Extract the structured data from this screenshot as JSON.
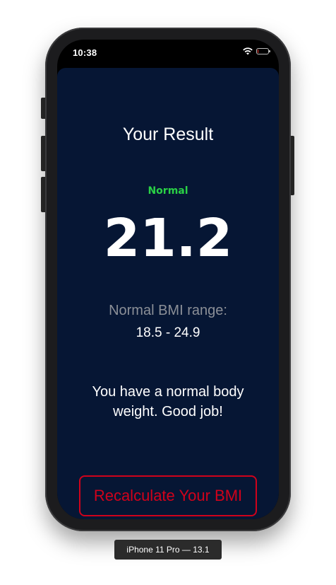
{
  "status_bar": {
    "time": "10:38",
    "battery_level": 0.1,
    "battery_color": "#ff3b30",
    "icons": [
      "wifi-icon",
      "battery-icon"
    ]
  },
  "result": {
    "title": "Your Result",
    "status": "Normal",
    "status_color": "#2ad146",
    "bmi": "21.2",
    "range_label": "Normal BMI range:",
    "range_value": "18.5 - 24.9",
    "interpretation": "You have a normal body weight. Good job!"
  },
  "actions": {
    "recalculate_label": "Recalculate Your BMI",
    "accent_color": "#d0021b"
  },
  "theme": {
    "background": "#061634"
  },
  "device": {
    "label": "iPhone 11 Pro — 13.1"
  }
}
